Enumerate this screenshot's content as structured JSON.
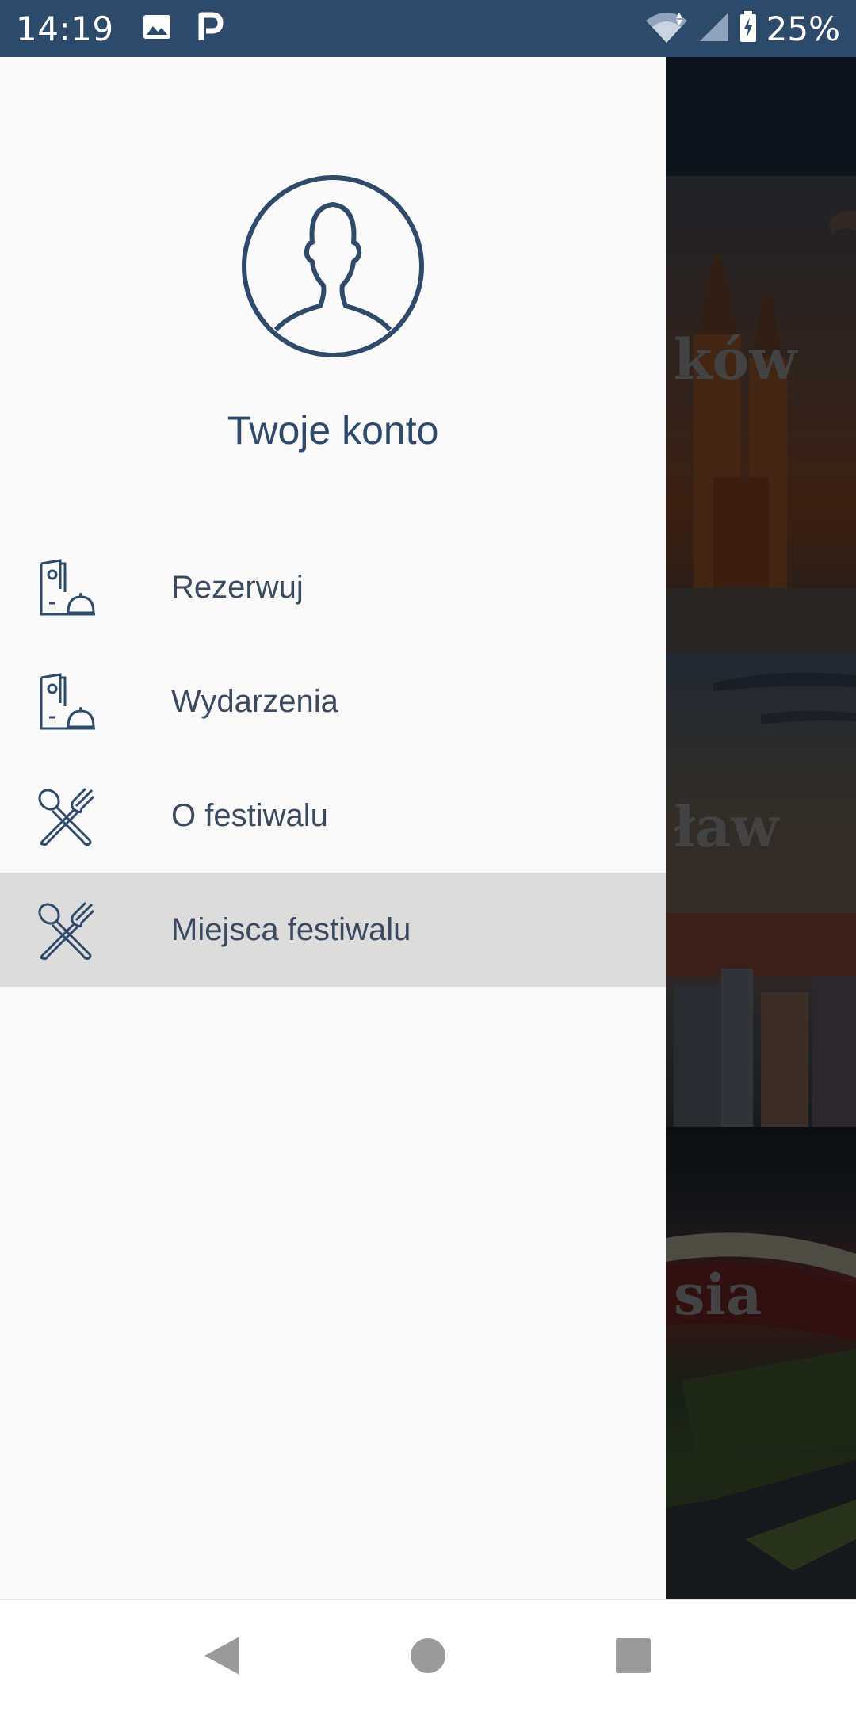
{
  "status_bar": {
    "time": "14:19",
    "battery": "25%",
    "icons": [
      "image-icon",
      "p-icon",
      "wifi-icon",
      "signal-icon",
      "battery-charging-icon"
    ],
    "background_color": "#2d4a6b"
  },
  "drawer": {
    "account_label": "Twoje konto",
    "accent_color": "#2f4a6b",
    "menu_items": [
      {
        "label": "Rezerwuj",
        "icon": "menu-bell-icon",
        "active": false
      },
      {
        "label": "Wydarzenia",
        "icon": "menu-bell-icon",
        "active": false
      },
      {
        "label": "O festiwalu",
        "icon": "utensils-icon",
        "active": false
      },
      {
        "label": "Miejsca festiwalu",
        "icon": "utensils-icon",
        "active": true
      }
    ]
  },
  "background_cards": [
    {
      "label_fragment": "ków"
    },
    {
      "label_fragment": "ław"
    },
    {
      "label_fragment": "sia"
    }
  ],
  "nav_bar": {
    "buttons": [
      "back-icon",
      "home-icon",
      "recents-icon"
    ]
  }
}
